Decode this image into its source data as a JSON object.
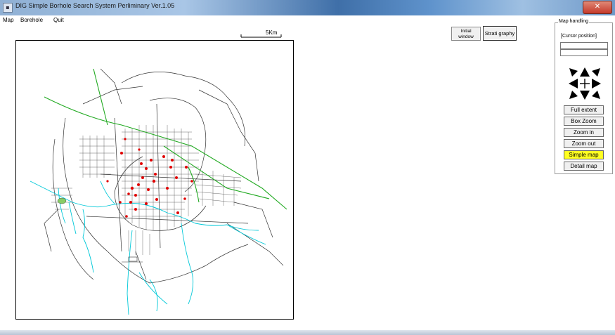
{
  "window": {
    "title": "DIG Simple Borhole Search System Perliminary Ver.1.05",
    "close_glyph": "✕"
  },
  "menu": [
    {
      "label": "Map"
    },
    {
      "label": "Borehole"
    },
    {
      "label": "Quit"
    }
  ],
  "scale_bar": {
    "label": "5Km"
  },
  "toolbar": {
    "initial_line1": "Initial",
    "initial_line2": "window",
    "strat_label": "Strati graphy"
  },
  "panel": {
    "title": "Map handling",
    "cursor_label": "[Cursor position]",
    "coord_x": "",
    "coord_y": "",
    "buttons": [
      {
        "label": "Full extent",
        "active": false
      },
      {
        "label": "Box Zoom",
        "active": false
      },
      {
        "label": "Zoom in",
        "active": false
      },
      {
        "label": "Zoom out",
        "active": false
      },
      {
        "label": "Simple map",
        "active": true
      },
      {
        "label": "Detail map",
        "active": false
      }
    ]
  },
  "colors": {
    "roads": "#333333",
    "rivers": "#00c8d8",
    "railway": "#22aa22",
    "boreholes": "#e00000",
    "highlight": "#ffff22"
  },
  "icons": [
    "app-icon",
    "close-icon",
    "pan-north-west-icon",
    "pan-north-icon",
    "pan-north-east-icon",
    "pan-west-icon",
    "center-cross-icon",
    "pan-east-icon",
    "pan-south-west-icon",
    "pan-south-icon",
    "pan-south-east-icon"
  ]
}
